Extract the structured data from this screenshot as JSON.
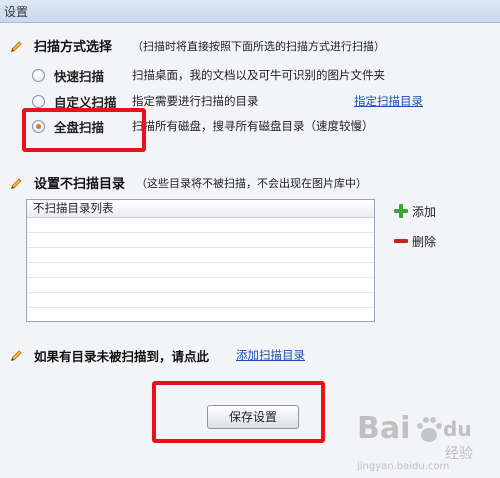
{
  "window": {
    "title": "设置"
  },
  "scan_section": {
    "title": "扫描方式选择",
    "note": "（扫描时将直接按照下面所选的扫描方式进行扫描）",
    "options": [
      {
        "label": "快速扫描",
        "desc": "扫描桌面，我的文档以及可牛可识别的图片文件夹",
        "checked": false
      },
      {
        "label": "自定义扫描",
        "desc": "指定需要进行扫描的目录",
        "checked": false,
        "link": "指定扫描目录"
      },
      {
        "label": "全盘扫描",
        "desc": "扫描所有磁盘，搜寻所有磁盘目录（速度较慢）",
        "checked": true
      }
    ]
  },
  "exclude_section": {
    "title": "设置不扫描目录",
    "note": "（这些目录将不被扫描，不会出现在图片库中）",
    "list_header": "不扫描目录列表",
    "rows": [],
    "add_label": "添加",
    "delete_label": "删除"
  },
  "missing_section": {
    "title": "如果有目录未被扫描到，请点此",
    "link": "添加扫描目录"
  },
  "save_button": "保存设置",
  "watermark": {
    "brand": "Bai",
    "brand2": "du",
    "brand_cn": "经验",
    "url": "jingyan.baidu.com"
  },
  "colors": {
    "highlight": "#e8131a",
    "link": "#1a4fb5",
    "accent": "#e07a1c"
  }
}
